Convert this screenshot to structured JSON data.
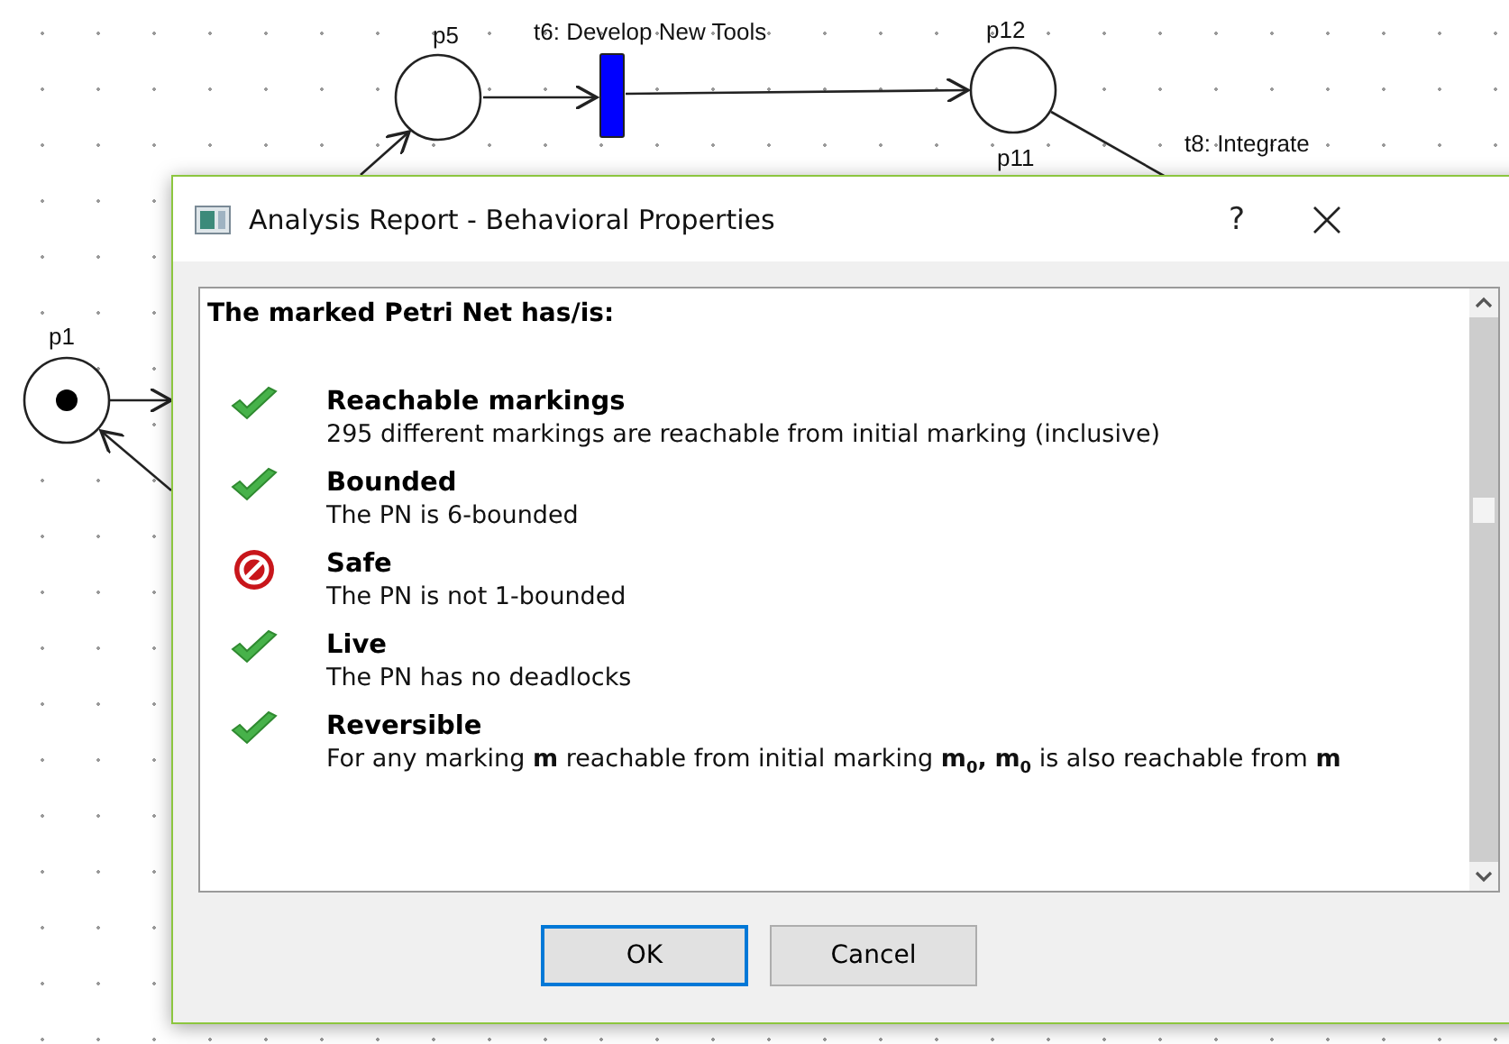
{
  "canvas": {
    "places": [
      {
        "label": "p5",
        "tokens": false
      },
      {
        "label": "p12",
        "tokens": false
      },
      {
        "label": "p11"
      },
      {
        "label": "p1",
        "tokens": true
      }
    ],
    "transitions": [
      {
        "label": "t6: Develop New Tools"
      },
      {
        "label": "t8: Integrate"
      }
    ]
  },
  "dialog": {
    "title": "Analysis Report - Behavioral Properties",
    "help": "?",
    "heading": "The marked Petri Net has/is:",
    "properties": [
      {
        "name": "Reachable markings",
        "detail": "295 different markings are reachable from initial marking (inclusive)",
        "holds": true
      },
      {
        "name": "Bounded",
        "detail": "The PN is 6-bounded",
        "holds": true
      },
      {
        "name": "Safe",
        "detail": "The PN is not 1-bounded",
        "holds": false
      },
      {
        "name": "Live",
        "detail": "The PN has no deadlocks",
        "holds": true
      },
      {
        "name": "Reversible",
        "detail": "For any marking **m** reachable from initial marking **m**$_{0}$**,** **m**$_{0}$ is also reachable from **m**",
        "holds": true
      }
    ],
    "buttons": [
      {
        "label": "OK",
        "selected": true
      },
      {
        "label": "Cancel",
        "selected": false
      }
    ]
  }
}
